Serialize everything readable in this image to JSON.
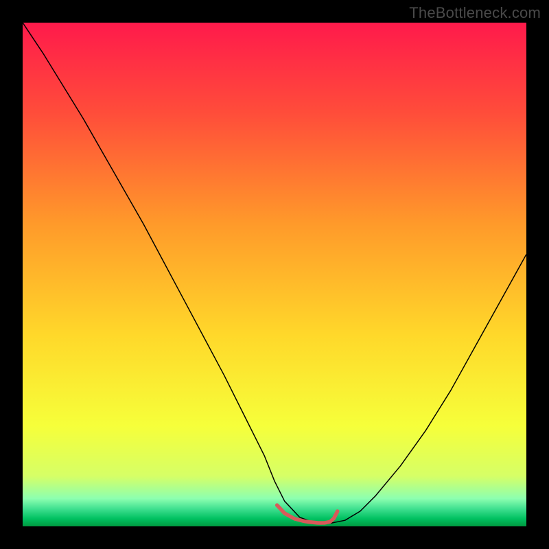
{
  "watermark": "TheBottleneck.com",
  "chart_data": {
    "type": "line",
    "title": "",
    "xlabel": "",
    "ylabel": "",
    "xlim": [
      0,
      100
    ],
    "ylim": [
      0,
      100
    ],
    "grid": false,
    "background_gradient": {
      "stops": [
        {
          "offset": 0.0,
          "color": "#ff1a4b"
        },
        {
          "offset": 0.18,
          "color": "#ff4d3a"
        },
        {
          "offset": 0.4,
          "color": "#ff9a2a"
        },
        {
          "offset": 0.62,
          "color": "#ffd82a"
        },
        {
          "offset": 0.8,
          "color": "#f6ff3a"
        },
        {
          "offset": 0.9,
          "color": "#d6ff66"
        },
        {
          "offset": 0.945,
          "color": "#8cffb0"
        },
        {
          "offset": 0.965,
          "color": "#40e090"
        },
        {
          "offset": 0.985,
          "color": "#00c060"
        },
        {
          "offset": 1.0,
          "color": "#009940"
        }
      ]
    },
    "series": [
      {
        "name": "deviation-curve",
        "color": "#000000",
        "width": 1.5,
        "x": [
          0,
          4,
          8,
          12,
          16,
          20,
          24,
          28,
          32,
          36,
          40,
          44,
          48,
          50,
          52,
          55,
          58,
          59,
          60,
          61,
          64,
          67,
          70,
          75,
          80,
          85,
          90,
          95,
          100
        ],
        "y": [
          100,
          94,
          87.5,
          81,
          74,
          67,
          60,
          52.5,
          45,
          37.5,
          30,
          22,
          14,
          9,
          5,
          1.8,
          0.7,
          0.5,
          0.5,
          0.6,
          1.2,
          3,
          6,
          12,
          19,
          27,
          36,
          45,
          54
        ]
      },
      {
        "name": "optimal-band",
        "is_marker_band": true,
        "color": "#d85a5a",
        "width": 5.5,
        "cap": "round",
        "x": [
          50.5,
          52,
          54,
          56,
          57,
          58,
          58.5,
          59,
          60,
          61,
          61.8,
          62.5
        ],
        "y": [
          4.2,
          2.6,
          1.5,
          1.0,
          0.85,
          0.75,
          0.7,
          0.68,
          0.7,
          0.9,
          1.6,
          3.0
        ]
      }
    ]
  }
}
